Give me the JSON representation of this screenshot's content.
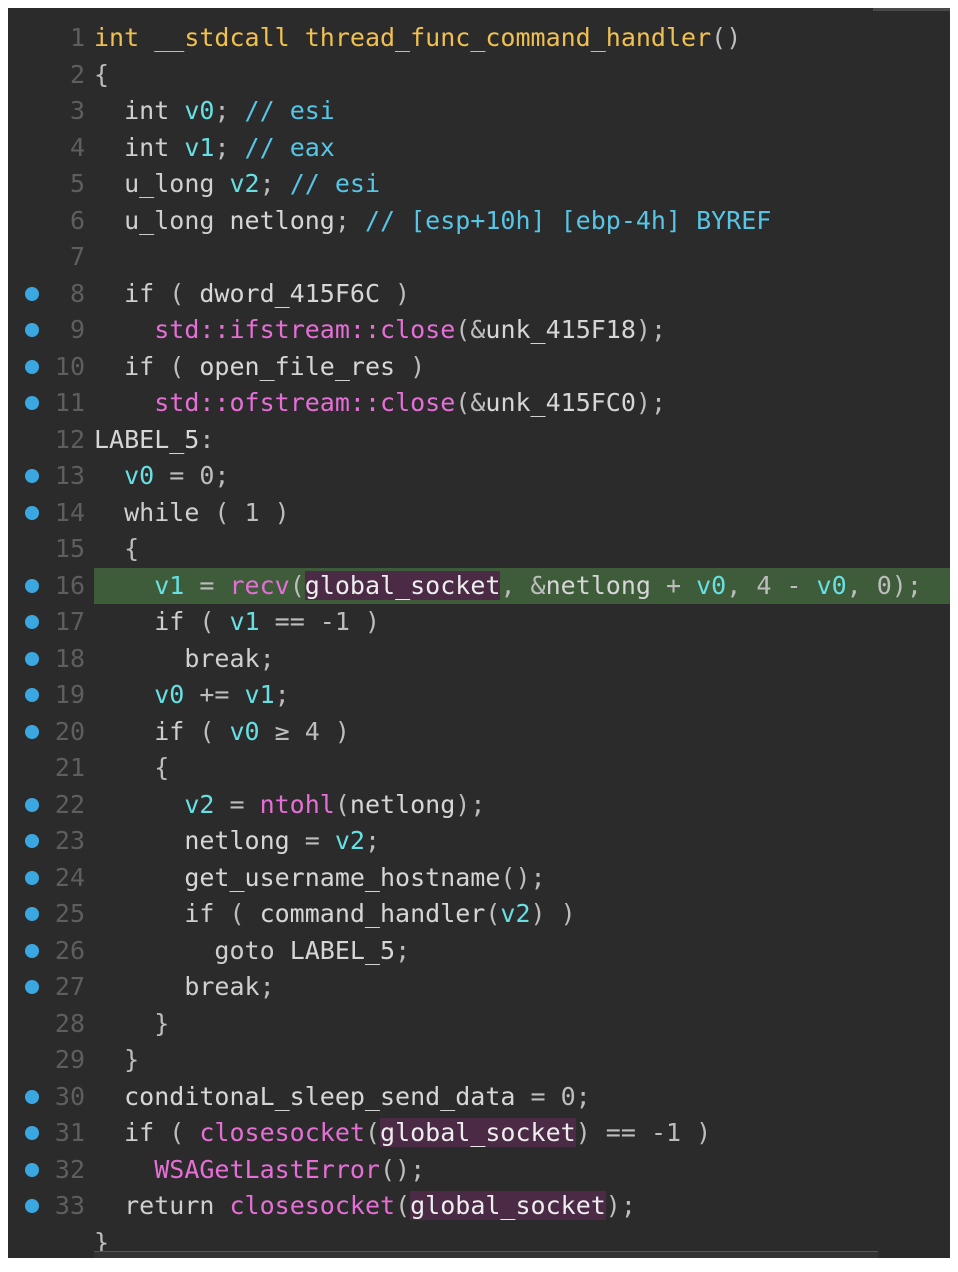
{
  "editor": {
    "lines": [
      {
        "no": "1",
        "bp": false,
        "code": "int __stdcall thread_func_command_handler()"
      },
      {
        "no": "2",
        "bp": false,
        "code": "{"
      },
      {
        "no": "3",
        "bp": false,
        "code": "  int v0; // esi"
      },
      {
        "no": "4",
        "bp": false,
        "code": "  int v1; // eax"
      },
      {
        "no": "5",
        "bp": false,
        "code": "  u_long v2; // esi"
      },
      {
        "no": "6",
        "bp": false,
        "code": "  u_long netlong; // [esp+10h] [ebp-4h] BYREF"
      },
      {
        "no": "7",
        "bp": false,
        "code": ""
      },
      {
        "no": "8",
        "bp": true,
        "code": "  if ( dword_415F6C )"
      },
      {
        "no": "9",
        "bp": true,
        "code": "    std::ifstream::close(&unk_415F18);"
      },
      {
        "no": "10",
        "bp": true,
        "code": "  if ( open_file_res )"
      },
      {
        "no": "11",
        "bp": true,
        "code": "    std::ofstream::close(&unk_415FC0);"
      },
      {
        "no": "12",
        "bp": false,
        "code": "LABEL_5:"
      },
      {
        "no": "13",
        "bp": true,
        "code": "  v0 = 0;"
      },
      {
        "no": "14",
        "bp": true,
        "code": "  while ( 1 )"
      },
      {
        "no": "15",
        "bp": false,
        "code": "  {"
      },
      {
        "no": "16",
        "bp": true,
        "code": "    v1 = recv(global_socket, &netlong + v0, 4 - v0, 0);",
        "highlight": true
      },
      {
        "no": "17",
        "bp": true,
        "code": "    if ( v1 == -1 )"
      },
      {
        "no": "18",
        "bp": true,
        "code": "      break;"
      },
      {
        "no": "19",
        "bp": true,
        "code": "    v0 += v1;"
      },
      {
        "no": "20",
        "bp": true,
        "code": "    if ( v0 ≥ 4 )"
      },
      {
        "no": "21",
        "bp": false,
        "code": "    {"
      },
      {
        "no": "22",
        "bp": true,
        "code": "      v2 = ntohl(netlong);"
      },
      {
        "no": "23",
        "bp": true,
        "code": "      netlong = v2;"
      },
      {
        "no": "24",
        "bp": true,
        "code": "      get_username_hostname();"
      },
      {
        "no": "25",
        "bp": true,
        "code": "      if ( command_handler(v2) )"
      },
      {
        "no": "26",
        "bp": true,
        "code": "        goto LABEL_5;"
      },
      {
        "no": "27",
        "bp": true,
        "code": "      break;"
      },
      {
        "no": "28",
        "bp": false,
        "code": "    }"
      },
      {
        "no": "29",
        "bp": false,
        "code": "  }"
      },
      {
        "no": "30",
        "bp": true,
        "code": "  conditonaL_sleep_send_data = 0;"
      },
      {
        "no": "31",
        "bp": true,
        "code": "  if ( closesocket(global_socket) == -1 )"
      },
      {
        "no": "32",
        "bp": true,
        "code": "    WSAGetLastError();"
      },
      {
        "no": "33",
        "bp": true,
        "code": "  return closesocket(global_socket);"
      },
      {
        "no": "",
        "bp": false,
        "code": "}"
      }
    ]
  },
  "colors": {
    "background": "#2b2b2b",
    "breakpoint": "#3aa7e0",
    "highlight_line": "#3e5c3a",
    "keyword": "#cfcfcf",
    "type": "#f0c050",
    "variable": "#67e0e3",
    "comment": "#57c6e6",
    "function": "#e56fd6",
    "global_highlight": "#4a2a45"
  }
}
